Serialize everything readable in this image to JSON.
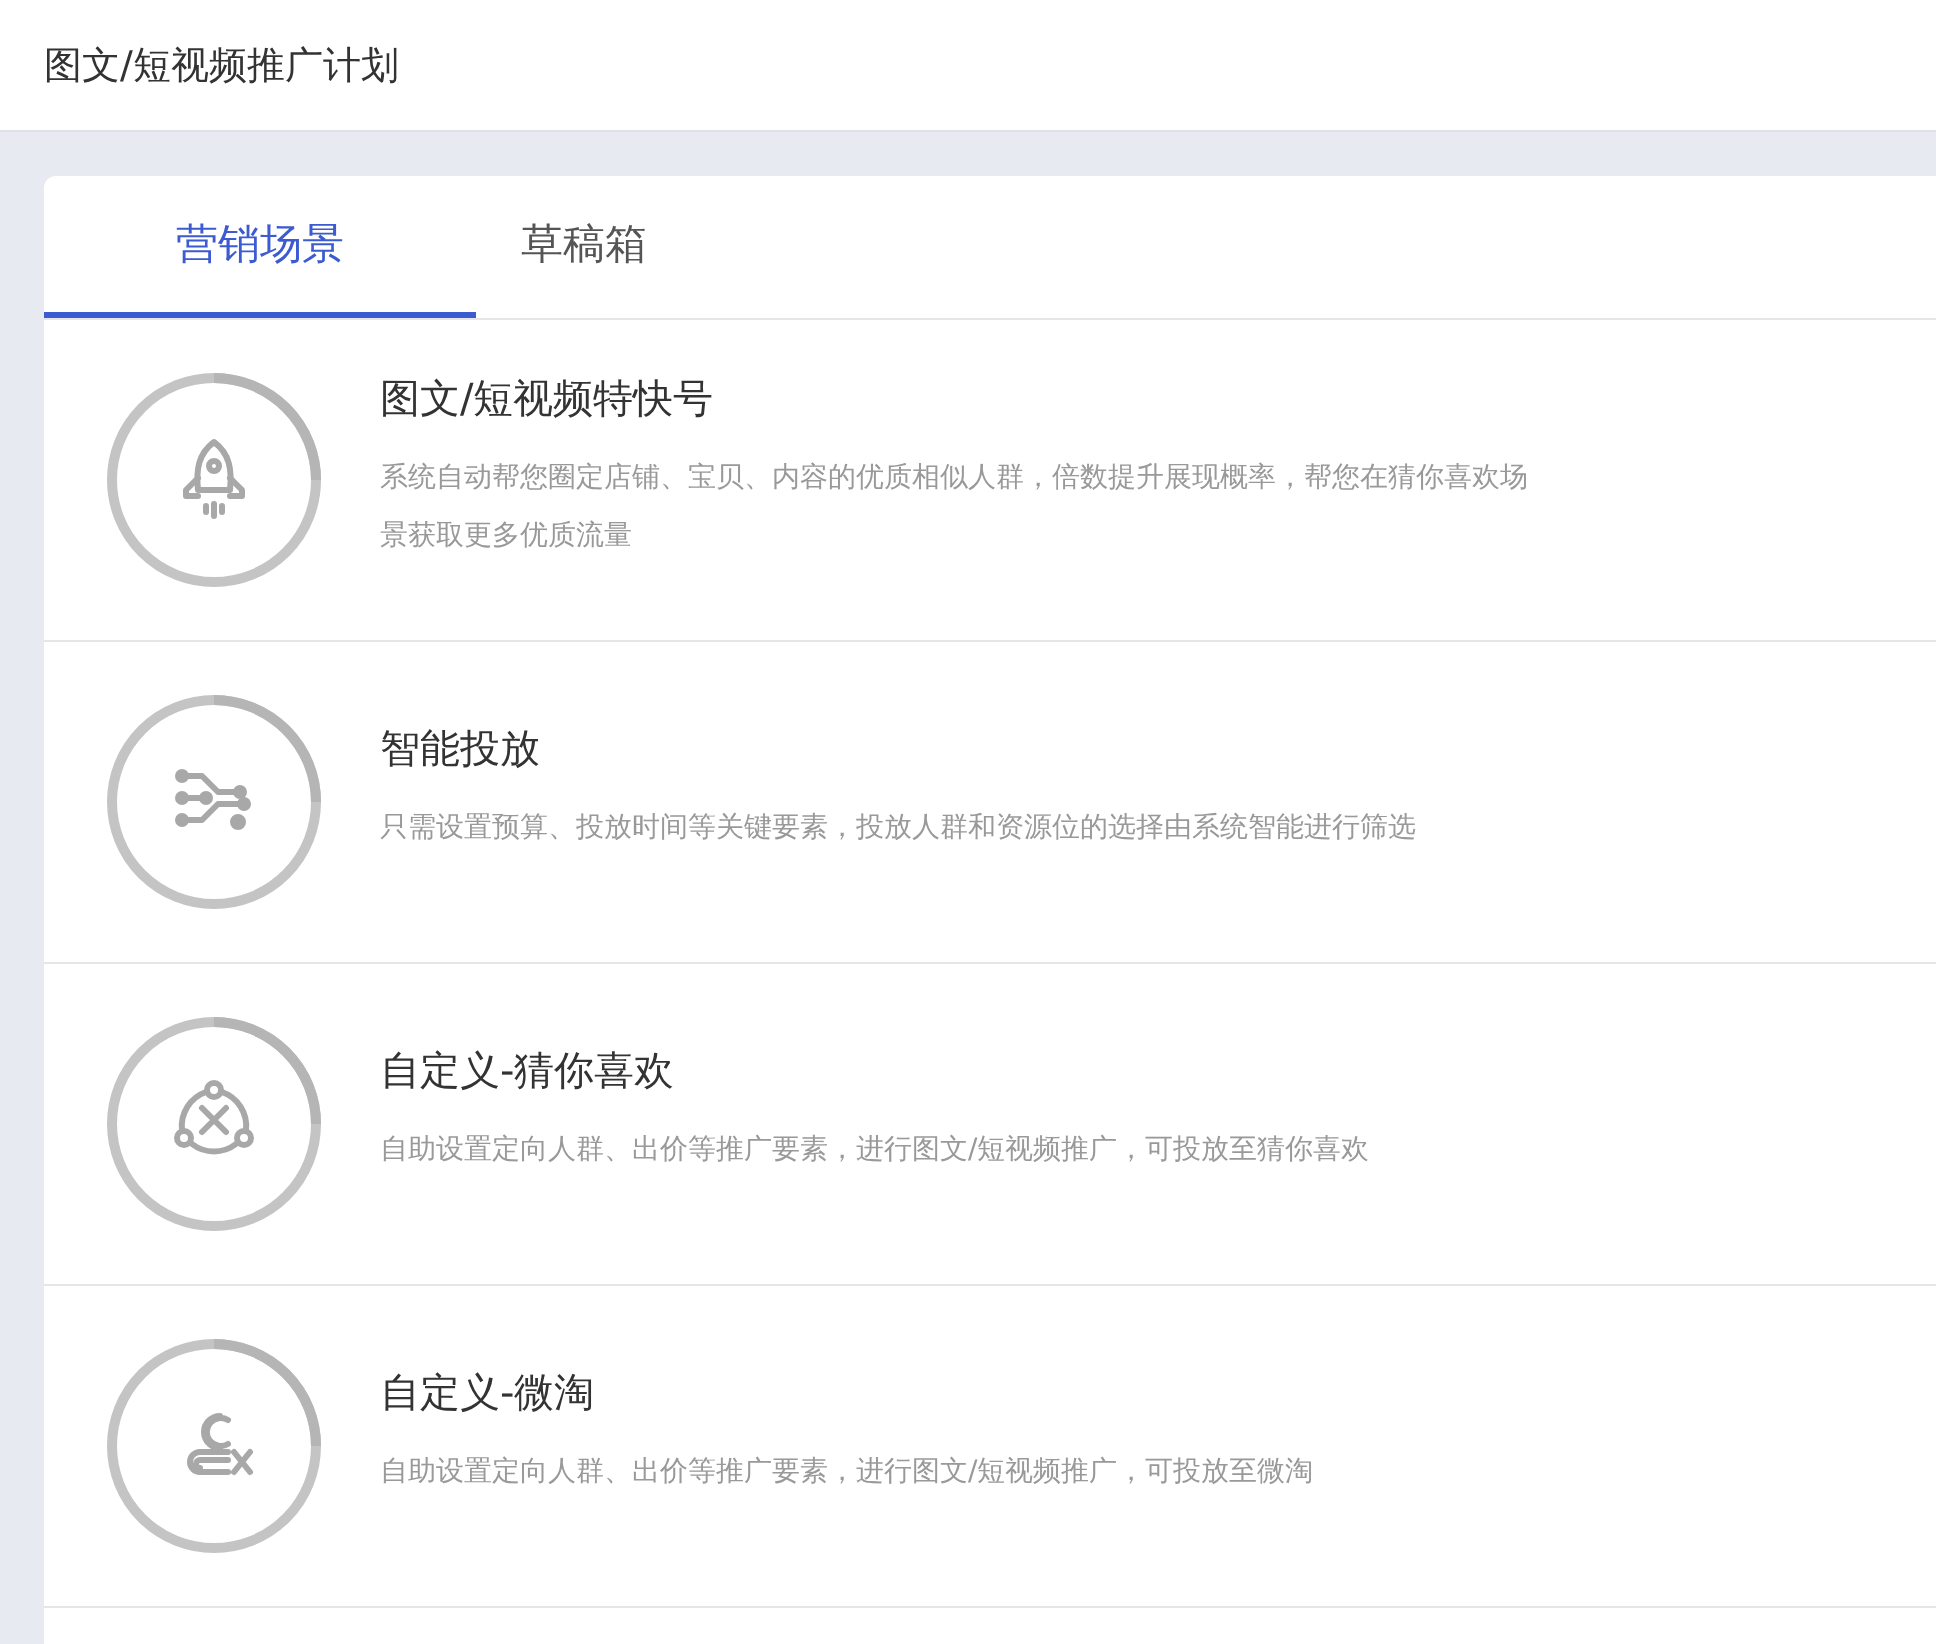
{
  "page": {
    "title": "图文/短视频推广计划"
  },
  "tabs": [
    {
      "label": "营销场景",
      "selected": true
    },
    {
      "label": "草稿箱",
      "selected": false
    }
  ],
  "scenes": [
    {
      "kind": "rocket",
      "title": "图文/短视频特快号",
      "description": "系统自动帮您圈定店铺、宝贝、内容的优质相似人群，倍数提升展现概率，帮您在猜你喜欢场景获取更多优质流量"
    },
    {
      "kind": "branch",
      "title": "智能投放",
      "description": "只需设置预算、投放时间等关键要素，投放人群和资源位的选择由系统智能进行筛选"
    },
    {
      "kind": "network",
      "title": "自定义-猜你喜欢",
      "description": "自助设置定向人群、出价等推广要素，进行图文/短视频推广，可投放至猜你喜欢"
    },
    {
      "kind": "person",
      "title": "自定义-微淘",
      "description": "自助设置定向人群、出价等推广要素，进行图文/短视频推广，可投放至微淘"
    }
  ]
}
